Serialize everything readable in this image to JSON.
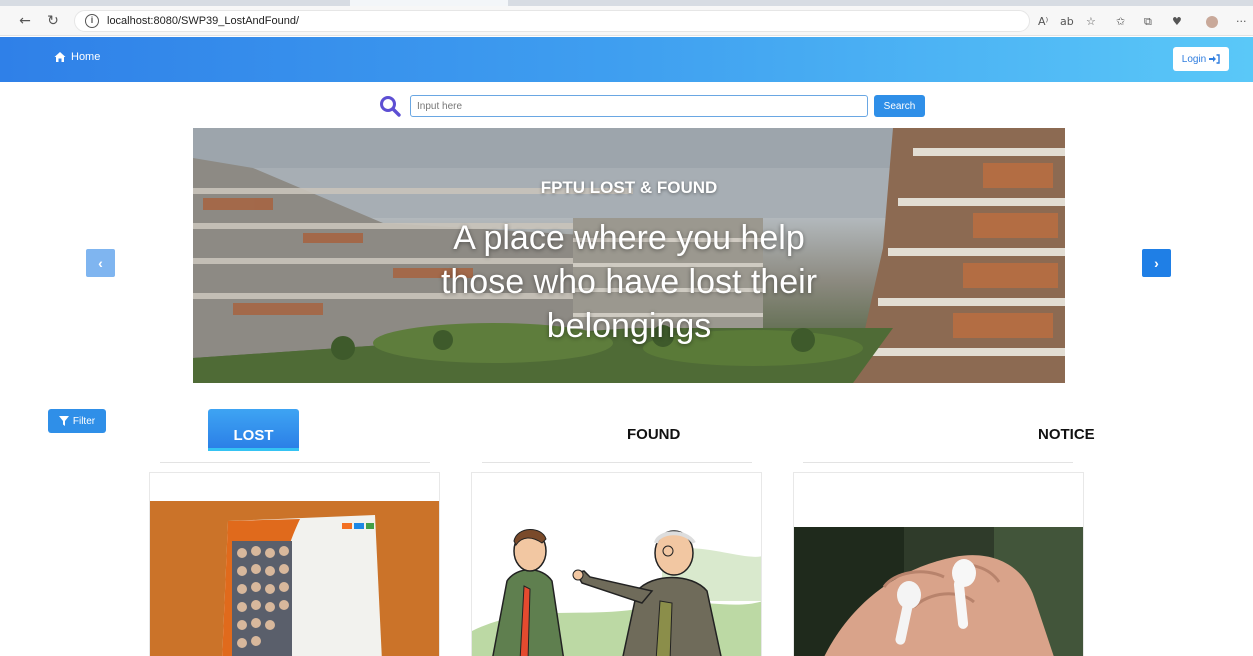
{
  "browser": {
    "url": "localhost:8080/SWP39_LostAndFound/",
    "back_icon": "arrow-left-icon",
    "refresh_icon": "refresh-icon"
  },
  "navbar": {
    "home_label": "Home",
    "login_label": "Login"
  },
  "search": {
    "placeholder": "Input here",
    "button_label": "Search"
  },
  "carousel": {
    "title": "FPTU LOST & FOUND",
    "text": "A place where you help those who have lost their belongings",
    "prev_icon": "chevron-left-icon",
    "next_icon": "chevron-right-icon"
  },
  "filter": {
    "label": "Filter"
  },
  "tabs": [
    {
      "label": "LOST",
      "active": true
    },
    {
      "label": "FOUND",
      "active": false
    },
    {
      "label": "NOTICE",
      "active": false
    }
  ],
  "cards": [
    {
      "image": "book-cover-image"
    },
    {
      "image": "cartoon-men-image"
    },
    {
      "image": "earbuds-image"
    }
  ],
  "colors": {
    "primary": "#2f8fe8",
    "navbar_start": "#2f80e8",
    "navbar_end": "#5ac8f8",
    "search_icon": "#5d4fd3"
  }
}
